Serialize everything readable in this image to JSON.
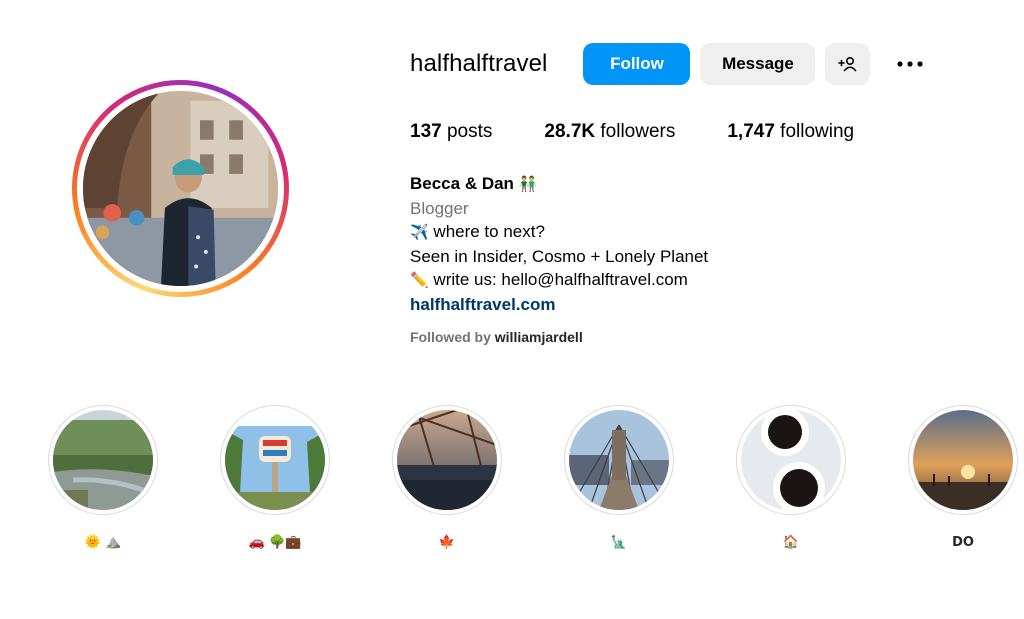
{
  "profile": {
    "username": "halfhalftravel",
    "follow_label": "Follow",
    "message_label": "Message",
    "add_user_icon": "add-user-icon",
    "more_icon": "more-options-icon"
  },
  "stats": {
    "posts_count": "137",
    "posts_label": " posts",
    "followers_count": "28.7K",
    "followers_label": " followers",
    "following_count": "1,747",
    "following_label": " following"
  },
  "bio": {
    "name": "Becca & Dan",
    "name_emoji": "👬",
    "category": "Blogger",
    "line1_emoji": "✈️",
    "line1": " where to next?",
    "line2": "Seen in Insider, Cosmo + Lonely Planet",
    "line3_emoji": "✏️",
    "line3": " write us: hello@halfhalftravel.com",
    "link": "halfhalftravel.com"
  },
  "followed_by": {
    "prefix": "Followed by ",
    "user": "williamjardell"
  },
  "highlights": [
    {
      "label": "🌞 ⛰️",
      "image": "river-forest"
    },
    {
      "label": "🚗 🌳💼",
      "image": "vegas-sign"
    },
    {
      "label": "🍁",
      "image": "city-sunset-tower"
    },
    {
      "label": "🗽",
      "image": "brooklyn-bridge"
    },
    {
      "label": "🏠",
      "image": "coffee-cups"
    },
    {
      "label": "DO",
      "image": "beach-sunset"
    }
  ],
  "colors": {
    "follow_button": "#0095f6",
    "secondary_button": "#efefef",
    "link": "#00376b",
    "muted_text": "#737373"
  }
}
